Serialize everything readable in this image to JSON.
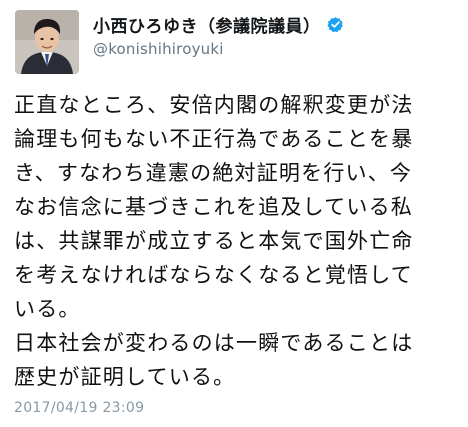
{
  "profile": {
    "display_name": "小西ひろゆき（参議院議員）",
    "handle": "@konishihiroyuki",
    "verified_color": "#1da1f2",
    "avatar_icon": "profile-photo"
  },
  "tweet": {
    "lines": [
      "正直なところ、安倍内閣の解釈変更が法",
      "論理も何もない不正行為であることを暴",
      "き、すなわち違憲の絶対証明を行い、今",
      "なお信念に基づきこれを追及している私",
      "は、共謀罪が成立すると本気で国外亡命",
      "を考えなければならなくなると覚悟して",
      "いる。",
      "日本社会が変わるのは一瞬であることは",
      "歴史が証明している。"
    ],
    "timestamp": "2017/04/19 23:09"
  }
}
